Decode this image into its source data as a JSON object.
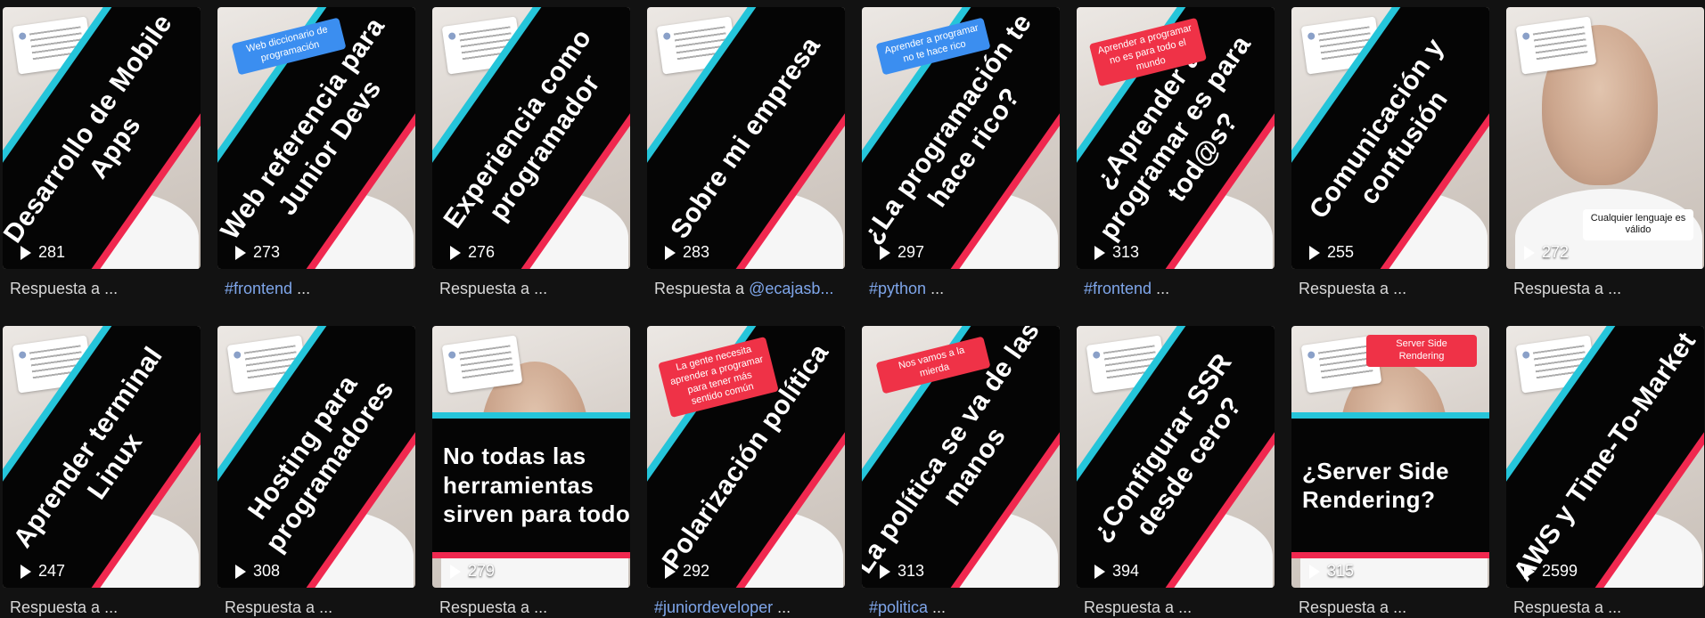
{
  "theme": {
    "background": "#121212",
    "caption_color": "#d8d8d8",
    "hashtag_color": "#7fa6ea",
    "banner_background": "#050505",
    "accent_cyan": "#25c5da",
    "accent_red": "#f0284f",
    "sticker_blue": "#3b8ef0",
    "sticker_red": "#ef3247"
  },
  "icons": {
    "play": "play-triangle-icon"
  },
  "videos": [
    {
      "title": "Desarrollo de Mobile Apps",
      "views": "281",
      "caption_tag": "",
      "caption_text": "Respuesta a ...",
      "sticker": "",
      "sticker_color": "",
      "has_comment_card": true,
      "layout": "diagonal"
    },
    {
      "title": "Web referencia para Junior Devs",
      "views": "273",
      "caption_tag": "#frontend",
      "caption_text": " ...",
      "sticker": "Web diccionario de programación",
      "sticker_color": "blue",
      "has_comment_card": false,
      "layout": "diagonal"
    },
    {
      "title": "Experiencia como programador",
      "views": "276",
      "caption_tag": "",
      "caption_text": "Respuesta a ...",
      "sticker": "",
      "sticker_color": "",
      "has_comment_card": true,
      "layout": "diagonal"
    },
    {
      "title": "Sobre mi empresa",
      "views": "283",
      "caption_tag": "",
      "caption_text": "Respuesta a ",
      "caption_mention": "@ecajasb...",
      "sticker": "",
      "sticker_color": "",
      "has_comment_card": true,
      "layout": "diagonal"
    },
    {
      "title": "¿La programación te hace rico?",
      "views": "297",
      "caption_tag": "#python",
      "caption_text": " ...",
      "sticker": "Aprender a programar no te hace rico",
      "sticker_color": "blue",
      "has_comment_card": false,
      "layout": "diagonal"
    },
    {
      "title": "¿Aprender a programar es para tod@s?",
      "views": "313",
      "caption_tag": "#frontend",
      "caption_text": " ...",
      "sticker": "Aprender a programar no es para todo el mundo",
      "sticker_color": "red",
      "has_comment_card": false,
      "layout": "diagonal"
    },
    {
      "title": "Comunicación y confusión",
      "views": "255",
      "caption_tag": "",
      "caption_text": "Respuesta a ...",
      "sticker": "",
      "sticker_color": "",
      "has_comment_card": true,
      "layout": "diagonal"
    },
    {
      "title": "",
      "views": "272",
      "caption_tag": "",
      "caption_text": "Respuesta a ...",
      "sticker": "Cualquier lenguaje es válido",
      "sticker_color": "white",
      "has_comment_card": true,
      "layout": "none"
    },
    {
      "title": "Aprender terminal Linux",
      "views": "247",
      "caption_tag": "",
      "caption_text": "Respuesta a ...",
      "sticker": "",
      "sticker_color": "",
      "has_comment_card": true,
      "layout": "diagonal"
    },
    {
      "title": "Hosting para programadores",
      "views": "308",
      "caption_tag": "",
      "caption_text": "Respuesta a ...",
      "sticker": "",
      "sticker_color": "",
      "has_comment_card": true,
      "layout": "diagonal"
    },
    {
      "title": "No todas las herramientas sirven para todo",
      "views": "279",
      "caption_tag": "",
      "caption_text": "Respuesta a ...",
      "sticker": "",
      "sticker_color": "",
      "has_comment_card": true,
      "layout": "flat"
    },
    {
      "title": "Polarización política",
      "views": "292",
      "caption_tag": "#juniordeveloper",
      "caption_text": " ...",
      "sticker": "La gente necesita aprender a programar para tener más sentido común",
      "sticker_color": "red",
      "has_comment_card": false,
      "layout": "diagonal"
    },
    {
      "title": "La política se va de las manos",
      "views": "313",
      "caption_tag": "#politica",
      "caption_text": " ...",
      "sticker": "Nos vamos a la mierda",
      "sticker_color": "red",
      "has_comment_card": false,
      "layout": "diagonal"
    },
    {
      "title": "¿Configurar SSR desde cero?",
      "views": "394",
      "caption_tag": "",
      "caption_text": "Respuesta a ...",
      "sticker": "",
      "sticker_color": "",
      "has_comment_card": true,
      "layout": "diagonal"
    },
    {
      "title": "¿Server Side Rendering?",
      "views": "315",
      "caption_tag": "",
      "caption_text": "Respuesta a ...",
      "sticker": "Server Side Rendering",
      "sticker_color": "red",
      "has_comment_card": true,
      "layout": "flat"
    },
    {
      "title": "AWS y Time-To-Market",
      "views": "2599",
      "caption_tag": "",
      "caption_text": "Respuesta a ...",
      "sticker": "",
      "sticker_color": "",
      "has_comment_card": true,
      "layout": "diagonal"
    }
  ]
}
